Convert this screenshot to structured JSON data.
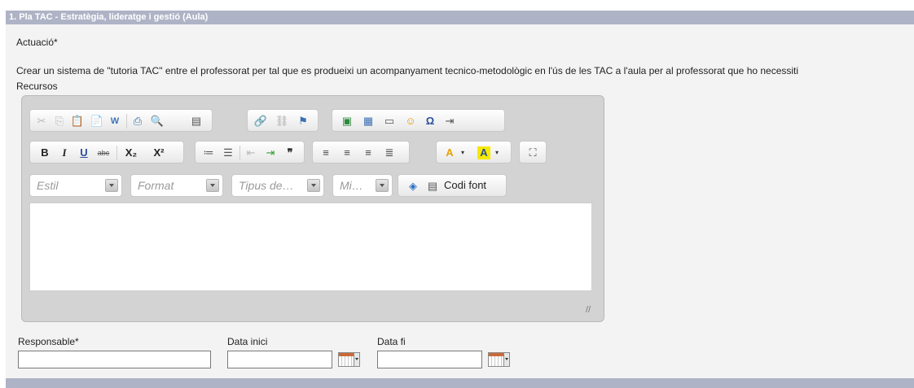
{
  "section": {
    "title": "1. Pla TAC - Estratègia, lideratge i gestió (Aula)"
  },
  "actuacio": {
    "label": "Actuació*",
    "text": "Crear un sistema de \"tutoria TAC\" entre el professorat per tal que es produeixi un acompanyament tecnico-metodològic en l'ús de les TAC a l'aula per al professorat que ho necessiti"
  },
  "recursos": {
    "label": "Recursos"
  },
  "editor": {
    "toolbar_row1": [
      "cut-icon",
      "copy-icon",
      "paste-icon",
      "paste-text-icon",
      "paste-word-icon",
      "print-icon",
      "preview-icon",
      "templates-icon",
      "link-icon",
      "unlink-icon",
      "anchor-icon",
      "image-icon",
      "table-icon",
      "horizontal-rule-icon",
      "smiley-icon",
      "special-char-icon",
      "page-break-icon"
    ],
    "toolbar_row2": [
      "bold",
      "italic",
      "underline",
      "strike",
      "subscript",
      "superscript",
      "numbered-list",
      "bulleted-list",
      "outdent",
      "indent",
      "blockquote",
      "align-left",
      "align-center",
      "align-right",
      "justify",
      "text-color",
      "background-color",
      "maximize"
    ],
    "glyphs": {
      "cut": "✂",
      "copy": "⎘",
      "paste": "📋",
      "paste_text": "📄",
      "paste_word": "W",
      "print": "⎙",
      "preview": "🔍",
      "templates": "▤",
      "link": "🔗",
      "unlink": "⛓",
      "anchor": "⚑",
      "image": "▣",
      "table": "▦",
      "hr": "▭",
      "smiley": "☺",
      "special_char": "Ω",
      "page_break": "⇥",
      "bold": "B",
      "italic": "I",
      "underline": "U",
      "strike": "abc",
      "subscript": "X₂",
      "superscript": "X²",
      "numbered_list": "≔",
      "bulleted_list": "☰",
      "outdent": "⇤",
      "indent": "⇥",
      "blockquote": "❞",
      "align_left": "≡",
      "align_center": "≡",
      "align_right": "≡",
      "justify": "≣",
      "text_color": "A",
      "bg_color": "A",
      "maximize": "⛶",
      "show_blocks": "◈",
      "source": "▤"
    },
    "combos": {
      "style": "Estil",
      "format": "Format",
      "font": "Tipus de…",
      "size": "Mi…"
    },
    "source_label": "Codi font",
    "colors": {
      "text_color_accent": "#e8a000",
      "bg_color_accent": "#f6e800"
    }
  },
  "form": {
    "responsable_label": "Responsable*",
    "responsable_value": "",
    "data_inici_label": "Data inici",
    "data_inici_value": "",
    "data_fi_label": "Data fi",
    "data_fi_value": ""
  },
  "colors": {
    "section_bar": "#aeb3c6",
    "content_bg": "#f3f3f3"
  }
}
